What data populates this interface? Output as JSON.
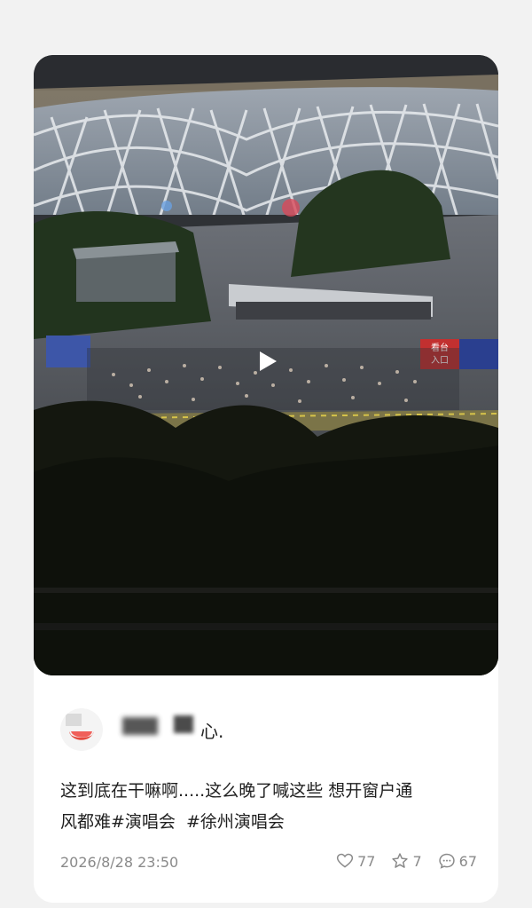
{
  "post": {
    "author_name": "心.",
    "text": "这到底在干嘛啊.....这么晚了喊这些 想开窗户通\n风都难#演唱会  #徐州演唱会",
    "timestamp": "2026/8/28 23:50"
  },
  "media": {
    "type": "video",
    "sign_text": "看台\n入口"
  },
  "stats": {
    "likes": "77",
    "favorites": "7",
    "comments": "67"
  },
  "icons": {
    "play": "play-icon",
    "like": "heart-icon",
    "favorite": "star-icon",
    "comment": "comment-icon"
  }
}
